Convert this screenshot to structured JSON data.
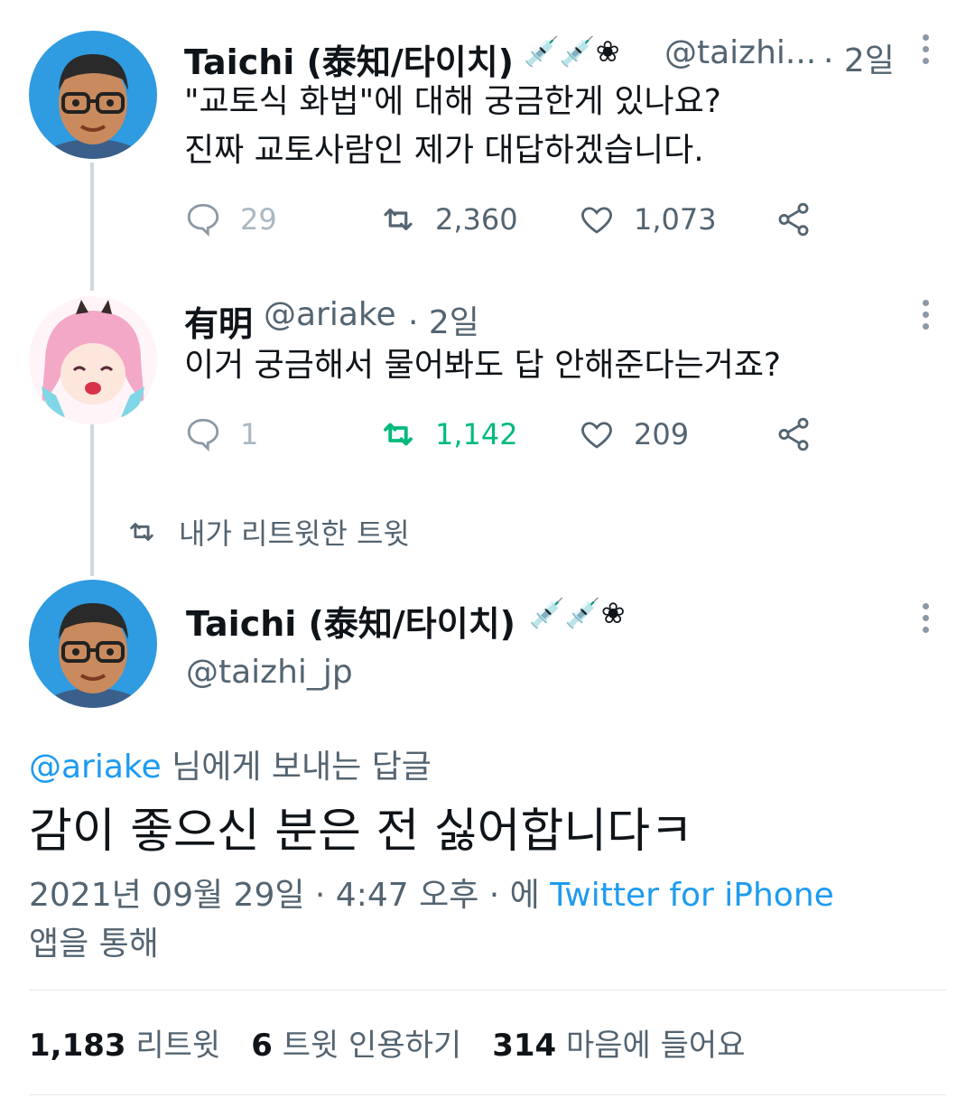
{
  "tweet1": {
    "author_name": "Taichi (泰知/타이치)",
    "author_badge": "💉💉❀",
    "handle_truncated": "@taizhi...",
    "time": "· 2일",
    "line1": "\"교토식 화법\"에 대해 궁금한게 있나요?",
    "line2": "진짜 교토사람인 제가 대답하겠습니다.",
    "replies": "29",
    "retweets": "2,360",
    "likes": "1,073"
  },
  "tweet2": {
    "author_name": "有明",
    "handle": "@ariake",
    "time": "· 2일",
    "text": "이거 궁금해서 물어봐도 답 안해준다는거죠?",
    "replies": "1",
    "retweets": "1,142",
    "likes": "209"
  },
  "retweet_context": "내가 리트윗한 트윗",
  "main": {
    "author_name": "Taichi (泰知/타이치)",
    "author_badge": "💉💉❀",
    "handle": "@taizhi_jp",
    "replying_to_handle": "@ariake",
    "replying_to_suffix": " 님에게 보내는 답글",
    "text": "감이 좋으신 분은 전 싫어합니다ㅋ",
    "timestamp": "2021년 09월 29일 · 4:47 오후 · 에 ",
    "source": "Twitter for iPhone",
    "source_suffix": "앱을 통해"
  },
  "stats": {
    "retweets_count": "1,183",
    "retweets_label": "리트윗",
    "quotes_count": "6",
    "quotes_label": "트윗 인용하기",
    "likes_count": "314",
    "likes_label": "마음에 들어요"
  },
  "colors": {
    "accent": "#1d9bf0",
    "retweet_active": "#00ba7c",
    "muted": "#536471"
  }
}
